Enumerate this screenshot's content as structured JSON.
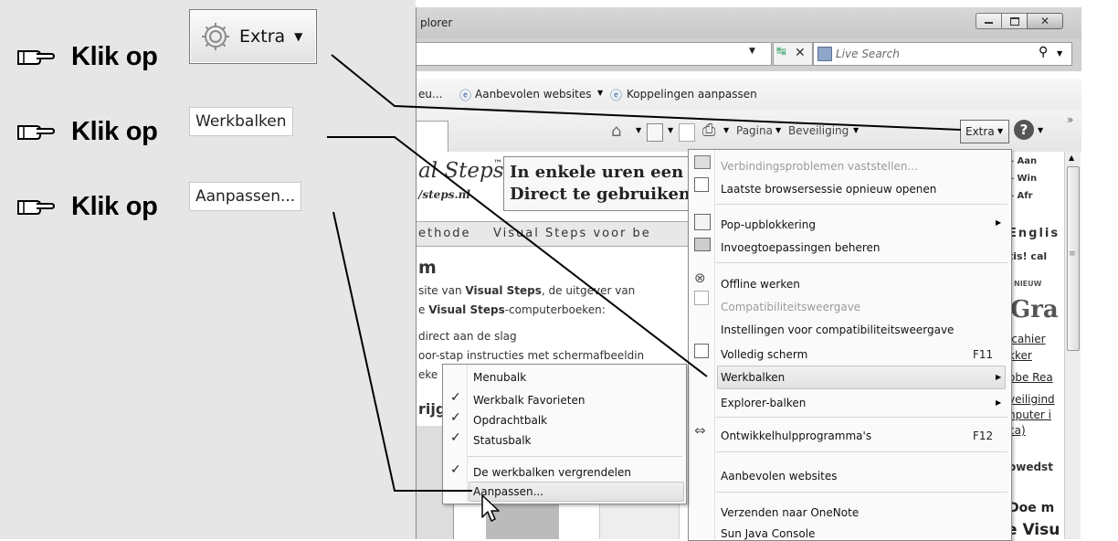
{
  "instructions": {
    "step_text": "Klik op",
    "extra_button": "Extra",
    "werkbalken": "Werkbalken",
    "aanpassen": "Aanpassen..."
  },
  "browser": {
    "title": "plorer",
    "search_placeholder": "Live Search",
    "favorites": [
      "eu...",
      "Aanbevolen websites",
      "Koppelingen aanpassen"
    ],
    "cmd": {
      "pagina": "Pagina",
      "beveiliging": "Beveiliging",
      "extra": "Extra"
    }
  },
  "page": {
    "banner_logo": "al Steps",
    "banner_tm": "™",
    "banner_url": "/steps.nl",
    "banner_line1": "In enkele uren een co",
    "banner_line2": "Direct te gebruiken i",
    "nav_left": "ethode",
    "nav_right": "Visual Steps voor be",
    "heading": "m",
    "p1_a": "site van ",
    "p1_b": "Visual Steps",
    "p1_c": ", de uitgever van",
    "p2_a": "e ",
    "p2_b": "Visual Steps",
    "p2_c": "-computerboeken:",
    "p3": " direct aan de slag",
    "p4": "oor-stap instructies met schermafbeeldin",
    "p5": "eke",
    "p6": "rijg",
    "right_items": [
      "– Aan",
      "– Win",
      "– Afr"
    ],
    "right_engl": "Englis",
    "right_tis": "tis! cal",
    "nieuw": "NIEUW",
    "gra": "Gra",
    "links": [
      "icahier",
      "kker",
      "obe Rea",
      "veiligind",
      "nputer i",
      "ca)"
    ],
    "owedst": "owedst",
    "doe": "Doe m",
    "visu": "e Visu"
  },
  "extra_menu": {
    "items": [
      {
        "label": "Verbindingsproblemen vaststellen...",
        "disabled": true
      },
      {
        "label": "Laatste browsersessie opnieuw openen"
      },
      {
        "label": "Pop-upblokkering"
      },
      {
        "label": "Invoegtoepassingen beheren"
      },
      {
        "label": "Offline werken"
      },
      {
        "label": "Compatibiliteitsweergave",
        "disabled": true
      },
      {
        "label": "Instellingen voor compatibiliteitsweergave"
      },
      {
        "label": "Volledig scherm",
        "shortcut": "F11"
      },
      {
        "label": "Werkbalken"
      },
      {
        "label": "Explorer-balken"
      },
      {
        "label": "Ontwikkelhulpprogramma's",
        "shortcut": "F12"
      },
      {
        "label": "Aanbevolen websites"
      },
      {
        "label": "Verzenden naar OneNote"
      },
      {
        "label": "Sun Java Console"
      }
    ]
  },
  "toolbars_menu": {
    "items": [
      {
        "label": "Menubalk",
        "checked": false
      },
      {
        "label": "Werkbalk Favorieten",
        "checked": true
      },
      {
        "label": "Opdrachtbalk",
        "checked": true
      },
      {
        "label": "Statusbalk",
        "checked": true
      },
      {
        "label": "De werkbalken vergrendelen",
        "checked": true
      },
      {
        "label": "Aanpassen...",
        "checked": false
      }
    ]
  }
}
